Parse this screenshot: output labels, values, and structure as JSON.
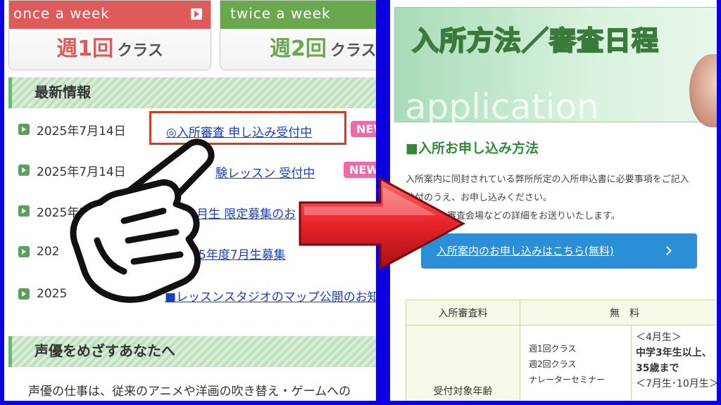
{
  "left": {
    "class1": {
      "header": "once a week",
      "big": "週1回",
      "small": "クラス"
    },
    "class2": {
      "header": "twice a week",
      "big": "週2回",
      "small": "クラス"
    },
    "news_title": "最新情報",
    "news": [
      {
        "date": "2025年7月14日",
        "link": "◎入所審査 申し込み受付中",
        "badge": "NEW"
      },
      {
        "date": "2025年7月14日",
        "link": "験レッスン 受付中",
        "badge": "NEWS"
      },
      {
        "date": "2025年7",
        "link": "0月生 限定募集のお"
      },
      {
        "date": "202",
        "link": "5年度7月生募集"
      },
      {
        "date": "2025",
        "link": "■レッスンスタジオのマップ公開のお知"
      }
    ],
    "section2_title": "声優をめざすあなたへ",
    "section2_text": "声優の仕事は、従来のアニメや洋画の吹き替え・ゲームへの"
  },
  "right": {
    "banner_title": "入所方法／審査日程",
    "banner_sub": "application",
    "heading": "■入所お申し込み方法",
    "para1": "入所案内に同封されている弊所所定の入所申込書に必要事項をご記入",
    "para2": "貼付のうえ、お申し込みください。",
    "para3": "、審査会場などの詳細をお送りいたします。",
    "button_label": "入所案内のお申し込みはこちら(無料)",
    "table": {
      "fee_label": "入所審査料",
      "fee_value": "無　料",
      "classes": [
        "週1回クラス",
        "週2回クラス",
        "ナレーターセミナー"
      ],
      "row_label": "受付対象年齢",
      "age_lines": [
        "＜4月生＞",
        "中学3年生以上、",
        "35歳まで",
        "＜7月生･10月生＞"
      ]
    }
  },
  "colors": {
    "frame": "#0a00e0",
    "class1": "#e05a5a",
    "class2": "#6aa84f",
    "arrow": "#e8242a",
    "highlight": "#d63a1a"
  }
}
